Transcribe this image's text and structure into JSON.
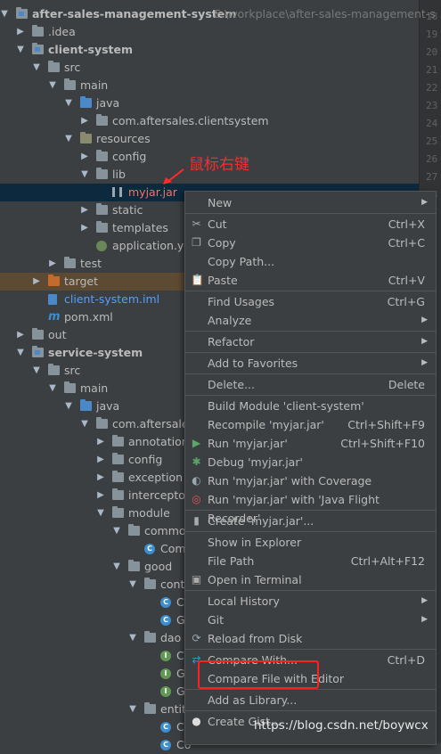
{
  "project_root": {
    "name": "after-sales-management-system",
    "path": "E:\\workplace\\after-sales-management-s"
  },
  "tree": [
    {
      "label": "after-sales-management-system",
      "indent": 0,
      "arrow": "down",
      "icon": "module-folder",
      "style": "bold",
      "path": "E:\\workplace\\after-sales-management-s"
    },
    {
      "label": ".idea",
      "indent": 1,
      "arrow": "right",
      "icon": "folder"
    },
    {
      "label": "client-system",
      "indent": 1,
      "arrow": "down",
      "icon": "module-folder",
      "style": "bold"
    },
    {
      "label": "src",
      "indent": 2,
      "arrow": "down",
      "icon": "folder"
    },
    {
      "label": "main",
      "indent": 3,
      "arrow": "down",
      "icon": "folder"
    },
    {
      "label": "java",
      "indent": 4,
      "arrow": "down",
      "icon": "src-folder"
    },
    {
      "label": "com.aftersales.clientsystem",
      "indent": 5,
      "arrow": "right",
      "icon": "package"
    },
    {
      "label": "resources",
      "indent": 4,
      "arrow": "down",
      "icon": "res-folder"
    },
    {
      "label": "config",
      "indent": 5,
      "arrow": "right",
      "icon": "folder"
    },
    {
      "label": "lib",
      "indent": 5,
      "arrow": "down",
      "icon": "folder"
    },
    {
      "label": "myjar.jar",
      "indent": 6,
      "arrow": "",
      "icon": "jar",
      "style": "red",
      "selected": true
    },
    {
      "label": "static",
      "indent": 5,
      "arrow": "right",
      "icon": "folder"
    },
    {
      "label": "templates",
      "indent": 5,
      "arrow": "right",
      "icon": "folder"
    },
    {
      "label": "application.yml",
      "indent": 5,
      "arrow": "",
      "icon": "spring"
    },
    {
      "label": "test",
      "indent": 3,
      "arrow": "right",
      "icon": "folder"
    },
    {
      "label": "target",
      "indent": 2,
      "arrow": "right",
      "icon": "orange-folder",
      "highlight": "target"
    },
    {
      "label": "client-system.iml",
      "indent": 2,
      "arrow": "",
      "icon": "iml",
      "style": "blue"
    },
    {
      "label": "pom.xml",
      "indent": 2,
      "arrow": "",
      "icon": "maven"
    },
    {
      "label": "out",
      "indent": 1,
      "arrow": "right",
      "icon": "folder"
    },
    {
      "label": "service-system",
      "indent": 1,
      "arrow": "down",
      "icon": "module-folder",
      "style": "bold"
    },
    {
      "label": "src",
      "indent": 2,
      "arrow": "down",
      "icon": "folder"
    },
    {
      "label": "main",
      "indent": 3,
      "arrow": "down",
      "icon": "folder"
    },
    {
      "label": "java",
      "indent": 4,
      "arrow": "down",
      "icon": "src-folder"
    },
    {
      "label": "com.aftersales",
      "indent": 5,
      "arrow": "down",
      "icon": "package"
    },
    {
      "label": "annotation",
      "indent": 6,
      "arrow": "right",
      "icon": "package"
    },
    {
      "label": "config",
      "indent": 6,
      "arrow": "right",
      "icon": "package"
    },
    {
      "label": "exception",
      "indent": 6,
      "arrow": "right",
      "icon": "package"
    },
    {
      "label": "interceptor",
      "indent": 6,
      "arrow": "right",
      "icon": "package"
    },
    {
      "label": "module",
      "indent": 6,
      "arrow": "down",
      "icon": "package"
    },
    {
      "label": "common",
      "indent": 7,
      "arrow": "down",
      "icon": "package"
    },
    {
      "label": "Comm",
      "indent": 8,
      "arrow": "",
      "icon": "class"
    },
    {
      "label": "good",
      "indent": 7,
      "arrow": "down",
      "icon": "package"
    },
    {
      "label": "contr",
      "indent": 8,
      "arrow": "down",
      "icon": "package"
    },
    {
      "label": "Ca",
      "indent": 9,
      "arrow": "",
      "icon": "class"
    },
    {
      "label": "Go",
      "indent": 9,
      "arrow": "",
      "icon": "class"
    },
    {
      "label": "dao",
      "indent": 8,
      "arrow": "down",
      "icon": "package"
    },
    {
      "label": "Ca",
      "indent": 9,
      "arrow": "",
      "icon": "interface"
    },
    {
      "label": "Go",
      "indent": 9,
      "arrow": "",
      "icon": "interface"
    },
    {
      "label": "Go",
      "indent": 9,
      "arrow": "",
      "icon": "interface"
    },
    {
      "label": "entity",
      "indent": 8,
      "arrow": "down",
      "icon": "package"
    },
    {
      "label": "Ca",
      "indent": 9,
      "arrow": "",
      "icon": "class"
    },
    {
      "label": "Co",
      "indent": 9,
      "arrow": "",
      "icon": "class"
    }
  ],
  "gutter_lines": [
    "18",
    "19",
    "20",
    "21",
    "22",
    "23",
    "24",
    "25",
    "26",
    "27",
    "28"
  ],
  "annotation_text": "鼠标右键",
  "context_menu": {
    "items": [
      {
        "label": "New",
        "shortcut": "",
        "submenu": true,
        "icon": ""
      },
      {
        "sep": true
      },
      {
        "label": "Cut",
        "shortcut": "Ctrl+X",
        "icon": "scissors-icon",
        "glyph": "✂"
      },
      {
        "label": "Copy",
        "shortcut": "Ctrl+C",
        "icon": "copy-icon",
        "glyph": "❐"
      },
      {
        "label": "Copy Path...",
        "shortcut": "",
        "icon": ""
      },
      {
        "label": "Paste",
        "shortcut": "Ctrl+V",
        "icon": "paste-icon",
        "glyph": "📋"
      },
      {
        "sep": true
      },
      {
        "label": "Find Usages",
        "shortcut": "Ctrl+G",
        "icon": ""
      },
      {
        "label": "Analyze",
        "shortcut": "",
        "submenu": true,
        "icon": ""
      },
      {
        "sep": true
      },
      {
        "label": "Refactor",
        "shortcut": "",
        "submenu": true,
        "icon": ""
      },
      {
        "sep": true
      },
      {
        "label": "Add to Favorites",
        "shortcut": "",
        "submenu": true,
        "icon": ""
      },
      {
        "sep": true
      },
      {
        "label": "Delete...",
        "shortcut": "Delete",
        "icon": ""
      },
      {
        "sep": true
      },
      {
        "label": "Build Module 'client-system'",
        "shortcut": "",
        "icon": ""
      },
      {
        "label": "Recompile 'myjar.jar'",
        "shortcut": "Ctrl+Shift+F9",
        "icon": ""
      },
      {
        "label": "Run 'myjar.jar'",
        "shortcut": "Ctrl+Shift+F10",
        "icon": "run-icon",
        "glyph": "▶"
      },
      {
        "label": "Debug 'myjar.jar'",
        "shortcut": "",
        "icon": "debug-icon",
        "glyph": "✱"
      },
      {
        "label": "Run 'myjar.jar' with Coverage",
        "shortcut": "",
        "icon": "coverage-icon",
        "glyph": "◐"
      },
      {
        "label": "Run 'myjar.jar' with 'Java Flight Recorder'",
        "shortcut": "",
        "icon": "flight-recorder-icon",
        "glyph": "◎"
      },
      {
        "sep": true
      },
      {
        "label": "Create 'myjar.jar'...",
        "shortcut": "",
        "icon": "create-config-icon",
        "glyph": "▮"
      },
      {
        "sep": true
      },
      {
        "label": "Show in Explorer",
        "shortcut": "",
        "icon": ""
      },
      {
        "label": "File Path",
        "shortcut": "Ctrl+Alt+F12",
        "icon": ""
      },
      {
        "label": "Open in Terminal",
        "shortcut": "",
        "icon": "terminal-icon",
        "glyph": "▣"
      },
      {
        "sep": true
      },
      {
        "label": "Local History",
        "shortcut": "",
        "submenu": true,
        "icon": ""
      },
      {
        "label": "Git",
        "shortcut": "",
        "submenu": true,
        "icon": ""
      },
      {
        "label": "Reload from Disk",
        "shortcut": "",
        "icon": "reload-icon",
        "glyph": "⟳"
      },
      {
        "sep": true
      },
      {
        "label": "Compare With...",
        "shortcut": "Ctrl+D",
        "icon": "compare-icon",
        "glyph": "⇄"
      },
      {
        "label": "Compare File with Editor",
        "shortcut": "",
        "icon": ""
      },
      {
        "sep": true
      },
      {
        "label": "Add as Library...",
        "shortcut": "",
        "icon": ""
      },
      {
        "sep": true
      },
      {
        "label": "Create Gist...",
        "shortcut": "",
        "icon": "github-icon",
        "glyph": "●"
      }
    ]
  },
  "watermark": "https://blog.csdn.net/boywcx"
}
